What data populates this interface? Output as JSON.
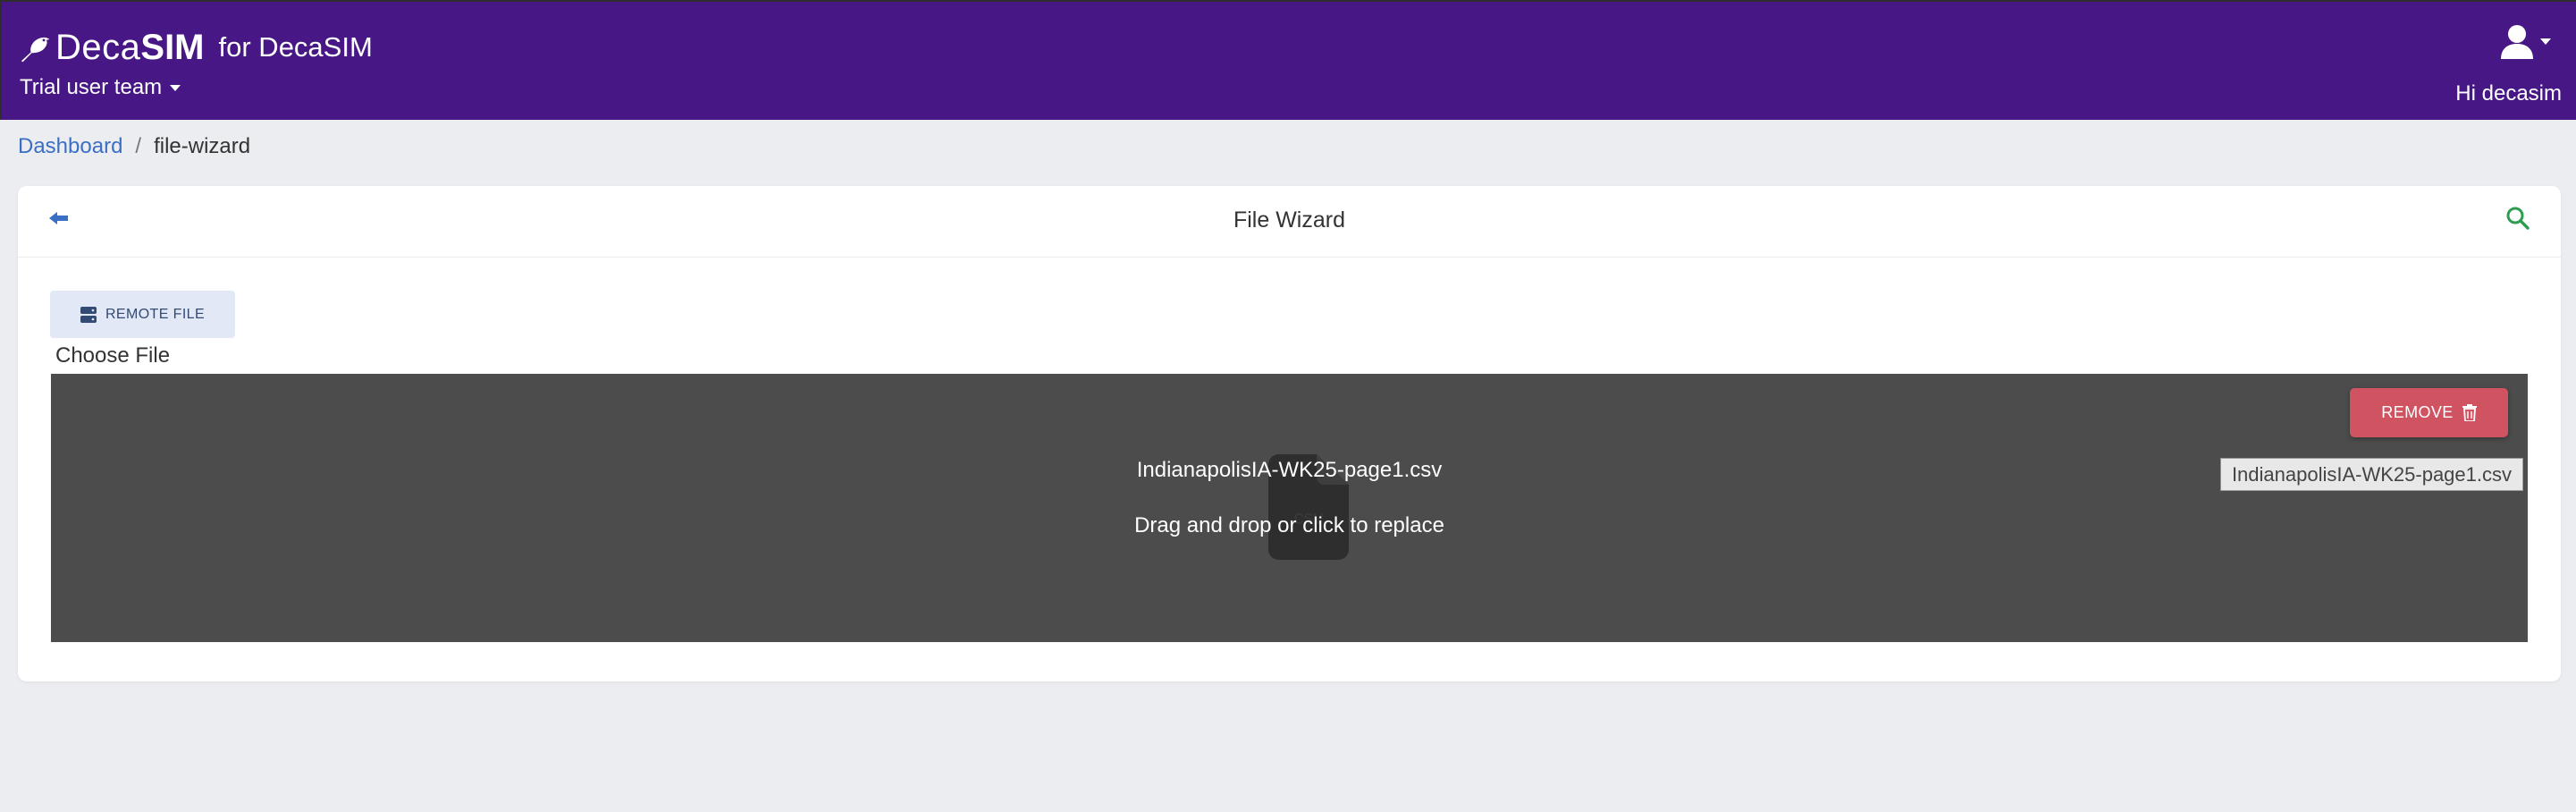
{
  "header": {
    "brand_light": "Deca",
    "brand_bold": "SIM",
    "brand_suffix": "for DecaSIM",
    "team": "Trial user team",
    "greeting": "Hi decasim",
    "bg_color": "#471786"
  },
  "breadcrumb": {
    "home": "Dashboard",
    "separator": "/",
    "current": "file-wizard"
  },
  "card": {
    "title": "File Wizard",
    "back_icon": "arrow-left-icon",
    "search_icon": "search-icon"
  },
  "upload": {
    "remote_button": "REMOTE FILE",
    "remote_icon": "server-icon",
    "choose_label": "Choose File",
    "filename": "IndianapolisIA-WK25-page1.csv",
    "message": "Drag and drop or click to replace",
    "remove_button": "REMOVE",
    "remove_icon": "trash-icon",
    "tooltip": "IndianapolisIA-WK25-page1.csv",
    "accent_remove": "#d05362"
  }
}
